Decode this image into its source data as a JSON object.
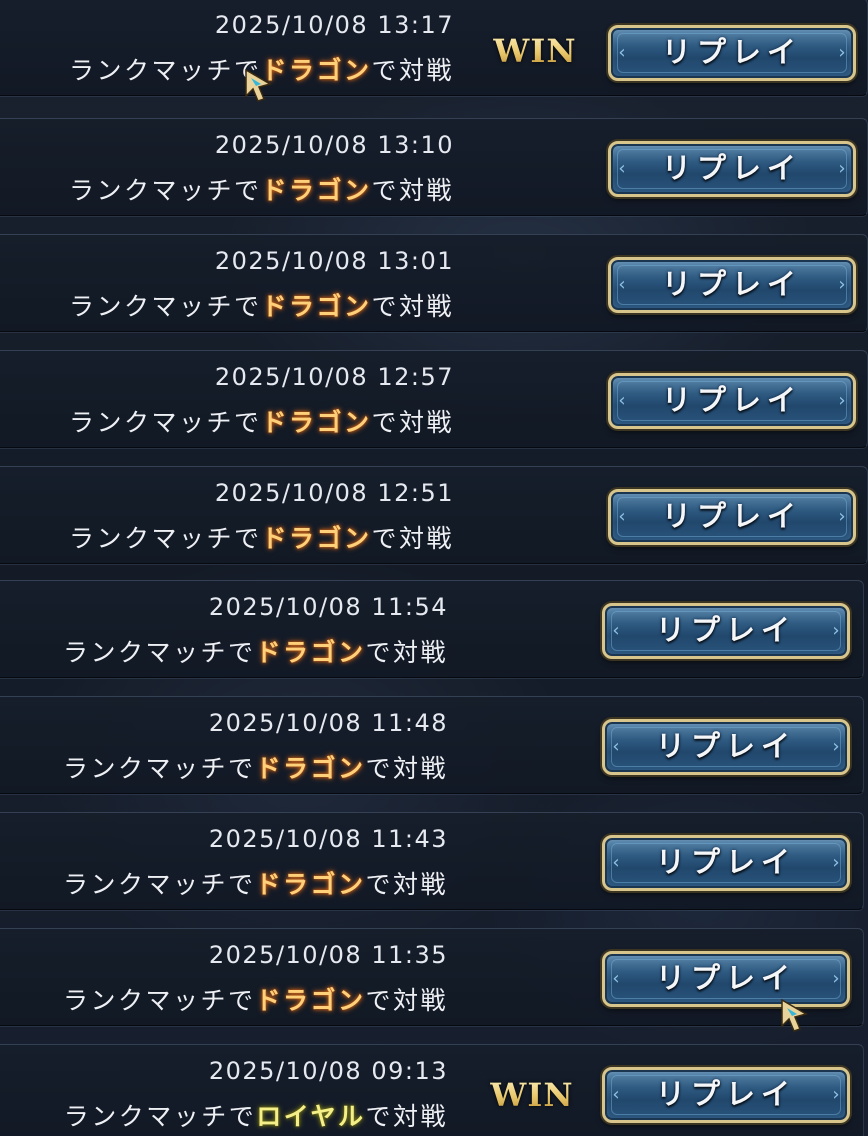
{
  "replay_label": "リプレイ",
  "win_label": "WIN",
  "rows": [
    {
      "datetime": "2025/10/08 13:17",
      "desc_pre": "ランクマッチで",
      "class_name": "ドラゴン",
      "desc_post": "で対戦",
      "result": "WIN"
    },
    {
      "datetime": "2025/10/08 13:10",
      "desc_pre": "ランクマッチで",
      "class_name": "ドラゴン",
      "desc_post": "で対戦",
      "result": ""
    },
    {
      "datetime": "2025/10/08 13:01",
      "desc_pre": "ランクマッチで",
      "class_name": "ドラゴン",
      "desc_post": "で対戦",
      "result": ""
    },
    {
      "datetime": "2025/10/08 12:57",
      "desc_pre": "ランクマッチで",
      "class_name": "ドラゴン",
      "desc_post": "で対戦",
      "result": ""
    },
    {
      "datetime": "2025/10/08 12:51",
      "desc_pre": "ランクマッチで",
      "class_name": "ドラゴン",
      "desc_post": "で対戦",
      "result": ""
    },
    {
      "datetime": "2025/10/08 11:54",
      "desc_pre": "ランクマッチで",
      "class_name": "ドラゴン",
      "desc_post": "で対戦",
      "result": ""
    },
    {
      "datetime": "2025/10/08 11:48",
      "desc_pre": "ランクマッチで",
      "class_name": "ドラゴン",
      "desc_post": "で対戦",
      "result": ""
    },
    {
      "datetime": "2025/10/08 11:43",
      "desc_pre": "ランクマッチで",
      "class_name": "ドラゴン",
      "desc_post": "で対戦",
      "result": ""
    },
    {
      "datetime": "2025/10/08 11:35",
      "desc_pre": "ランクマッチで",
      "class_name": "ドラゴン",
      "desc_post": "で対戦",
      "result": ""
    },
    {
      "datetime": "2025/10/08 09:13",
      "desc_pre": "ランクマッチで",
      "class_name": "ロイヤル",
      "desc_post": "で対戦",
      "result": "WIN"
    }
  ],
  "colors": {
    "class_dragon": "#ffd07a",
    "class_royal": "#f5ef8a",
    "win_gold": "#f6e3a0",
    "button_blue": "#2f5b82",
    "button_border": "#d8c58c"
  },
  "icons": {
    "cursor": "cursor-arrow-icon"
  }
}
